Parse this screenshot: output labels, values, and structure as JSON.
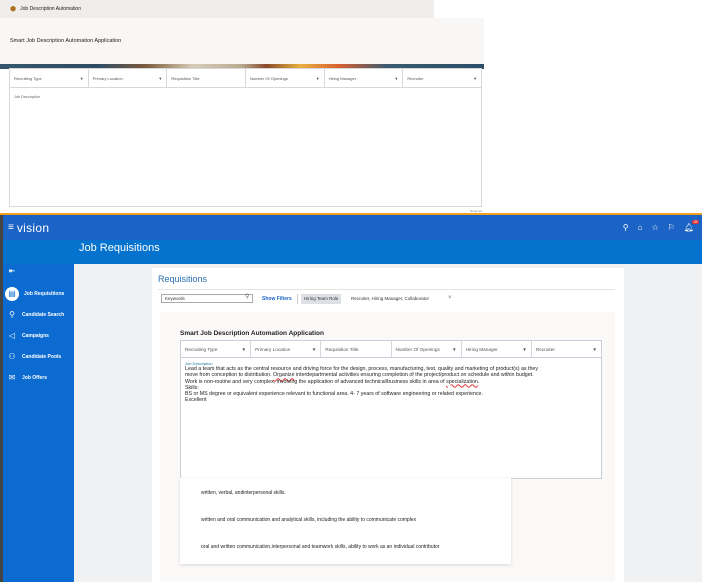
{
  "top_app": {
    "title": "Job Description Automation",
    "app_title": "Smart Job Description Automation Application",
    "fields": [
      "Recruiting Type",
      "Primary Location",
      "Requisition Title",
      "Number Of Openings",
      "Hiring Manager",
      "Recruiter"
    ],
    "job_description_label": "Job Description",
    "required_label": "Required"
  },
  "navbar": {
    "logo": "vision",
    "notification_count": "25"
  },
  "page": {
    "title": "Job Requisitions"
  },
  "sidebar": {
    "items": [
      {
        "label": "Job Requisitions",
        "active": true
      },
      {
        "label": "Candidate Search"
      },
      {
        "label": "Campaigns"
      },
      {
        "label": "Candidate Pools"
      },
      {
        "label": "Job Offers"
      }
    ]
  },
  "requisitions": {
    "title": "Requisitions",
    "keywords_placeholder": "Keywords",
    "show_filters": "Show Filters",
    "filter_chip_label": "Hiring Team Role",
    "filter_chip_value": "Recruiter, Hiring Manager, Collaborator"
  },
  "embedded_app": {
    "title": "Smart Job Description Automation Application",
    "fields": [
      "Recruiting Type",
      "Primary Location",
      "Requisition Title",
      "Number Of Openings",
      "Hiring Manager",
      "Recruiter"
    ],
    "job_description_label": "Job Description",
    "job_description_lines": [
      "Lead a team that acts as the central resource and driving force for the design, process, manufacturing, test, quality and marketing of product(s) as they",
      "move from conception to distribution.  Organize interdepartmental activities ensuring completion of the project/product on schedule and within budget.",
      "Work is non-routine and very complex, involving the application of advanced technical/business skills in area of specialization.",
      "Skills:",
      "BS or MS degree or equivalent experience relevant to functional area. 4- 7 years of software engineering or related experience.",
      "Excellent"
    ],
    "suggestions": [
      "written, verbal, andinterpersonal skills.",
      "written and oral communication and analytical skills, including the ability to communicate complex",
      "oral and written communication,interpersonal and teamwork skills, ability to work as an individual contributor"
    ]
  },
  "colors": {
    "nav": "#1b63c4",
    "band": "#0572ce",
    "sidebar": "#0b6bd0",
    "accent": "#f0a020"
  }
}
